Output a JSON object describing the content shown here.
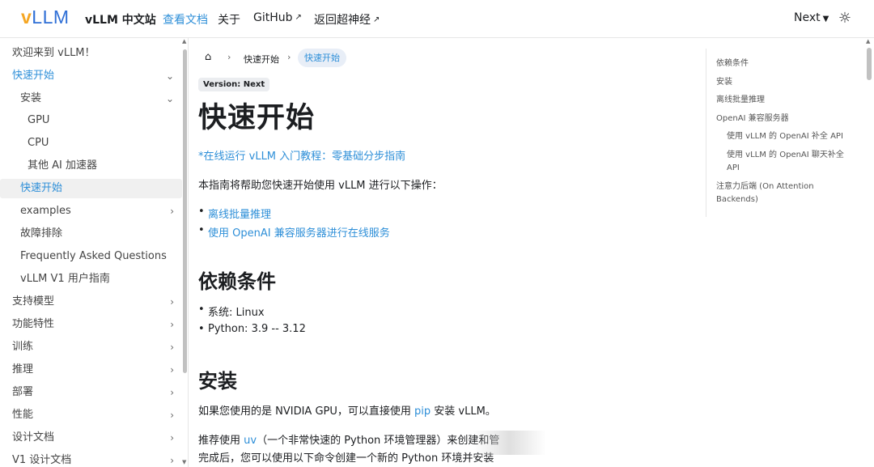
{
  "navbar": {
    "logo_v": "v",
    "logo_llm": "LLM",
    "site_title": "vLLM 中文站",
    "items": [
      {
        "label": "查看文档"
      },
      {
        "label": "关于"
      },
      {
        "label": "GitHub"
      },
      {
        "label": "返回超神经"
      }
    ],
    "version_label": "Next",
    "theme_icon": "sun-icon"
  },
  "sidebar": {
    "items": [
      {
        "label": "欢迎来到 vLLM！"
      },
      {
        "label": "快速开始"
      },
      {
        "label": "安装"
      },
      {
        "label": "GPU"
      },
      {
        "label": "CPU"
      },
      {
        "label": "其他 AI 加速器"
      },
      {
        "label": "快速开始"
      },
      {
        "label": "examples"
      },
      {
        "label": "故障排除"
      },
      {
        "label": "Frequently Asked Questions"
      },
      {
        "label": "vLLM V1 用户指南"
      },
      {
        "label": "支持模型"
      },
      {
        "label": "功能特性"
      },
      {
        "label": "训练"
      },
      {
        "label": "推理"
      },
      {
        "label": "部署"
      },
      {
        "label": "性能"
      },
      {
        "label": "设计文档"
      },
      {
        "label": "V1 设计文档"
      }
    ]
  },
  "breadcrumb": {
    "home_icon": "home-icon",
    "items": [
      "快速开始",
      "快速开始"
    ]
  },
  "content": {
    "version_badge": "Version: Next",
    "title": "快速开始",
    "tutorial_link": "*在线运行 vLLM 入门教程：零基础分步指南",
    "intro": "本指南将帮助您快速开始使用 vLLM 进行以下操作：",
    "intro_bullets": [
      "离线批量推理",
      "使用 OpenAI 兼容服务器进行在线服务"
    ],
    "h_deps": "依赖条件",
    "deps_bullets": [
      "系统: Linux",
      "Python: 3.9 -- 3.12"
    ],
    "h_install": "安装",
    "install_p1_a": "如果您使用的是 NVIDIA GPU，可以直接使用 ",
    "install_p1_link": "pip",
    "install_p1_b": " 安装 vLLM。",
    "install_p2_a": "推荐使用 ",
    "install_p2_link": "uv",
    "install_p2_b": "（一个非常快速的 Python 环境管理器）来创建和管",
    "install_p3": "完成后，您可以使用以下命令创建一个新的 Python 环境并安装"
  },
  "toc": {
    "items": [
      "依赖条件",
      "安装",
      "离线批量推理",
      "OpenAI 兼容服务器",
      "使用 vLLM 的 OpenAI 补全 API",
      "使用 vLLM 的 OpenAI 聊天补全",
      "API",
      "注意力后端 (On Attention",
      "Backends)"
    ]
  },
  "colors": {
    "accent": "#2e8fd8",
    "logo_v": "#f5a623",
    "logo_llm": "#2f6fd6"
  }
}
